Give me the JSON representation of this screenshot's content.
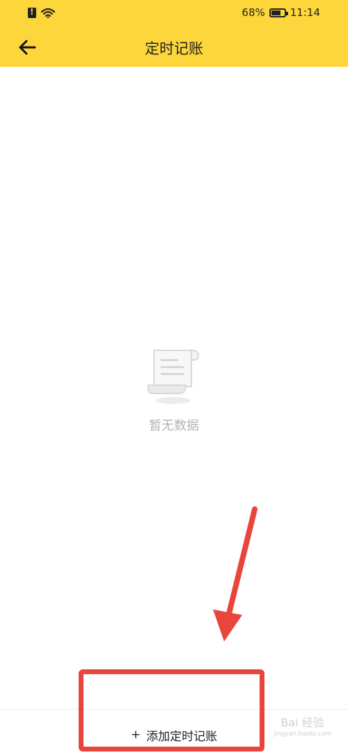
{
  "status_bar": {
    "battery_percent": "68%",
    "time": "11:14"
  },
  "header": {
    "title": "定时记账"
  },
  "empty_state": {
    "text": "暂无数据"
  },
  "bottom": {
    "add_label": "添加定时记账",
    "add_icon": "+"
  },
  "watermark": {
    "brand": "Bai 经验",
    "url": "jingyan.baidu.com"
  },
  "colors": {
    "header_bg": "#fcd63a",
    "annotation": "#e8453c",
    "empty_text": "#b3b3b3"
  }
}
